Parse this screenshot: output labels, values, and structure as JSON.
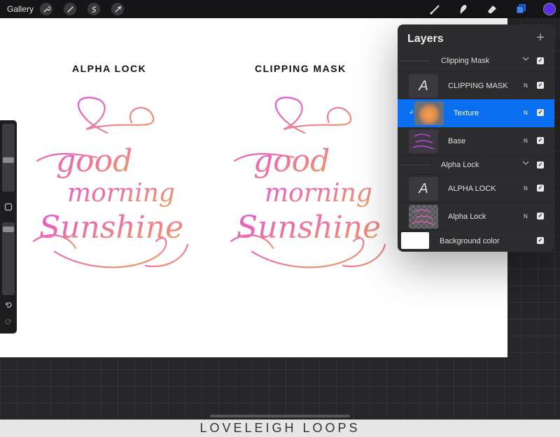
{
  "topbar": {
    "gallery_label": "Gallery",
    "left_tools": [
      "wrench-icon",
      "magic-wand-icon",
      "selection-icon",
      "transform-arrow-icon"
    ],
    "right_tools": [
      "brush-icon",
      "smudge-icon",
      "eraser-icon",
      "layers-icon"
    ],
    "current_color": "#5b2fe6"
  },
  "canvas": {
    "left_caption": "ALPHA LOCK",
    "right_caption": "CLIPPING MASK",
    "lettering_lines": [
      "good",
      "morning",
      "Sunshine"
    ],
    "gradient_colors": [
      "#e84fd8",
      "#f2a05a"
    ]
  },
  "layers_panel": {
    "title": "Layers",
    "rows": [
      {
        "kind": "group",
        "label": "Clipping Mask"
      },
      {
        "kind": "layer",
        "label": "CLIPPING MASK",
        "thumb": "text-layer",
        "blend": "N"
      },
      {
        "kind": "layer",
        "label": "Texture",
        "thumb": "texture",
        "blend": "N",
        "selected": true
      },
      {
        "kind": "layer",
        "label": "Base",
        "thumb": "lettering",
        "blend": "N"
      },
      {
        "kind": "group",
        "label": "Alpha Lock"
      },
      {
        "kind": "layer",
        "label": "ALPHA LOCK",
        "thumb": "text-layer",
        "blend": "N"
      },
      {
        "kind": "layer",
        "label": "Alpha Lock",
        "thumb": "lettering-locked",
        "blend": "N"
      },
      {
        "kind": "background",
        "label": "Background color"
      }
    ]
  },
  "footer": {
    "text": "LOVELEIGH LOOPS"
  }
}
